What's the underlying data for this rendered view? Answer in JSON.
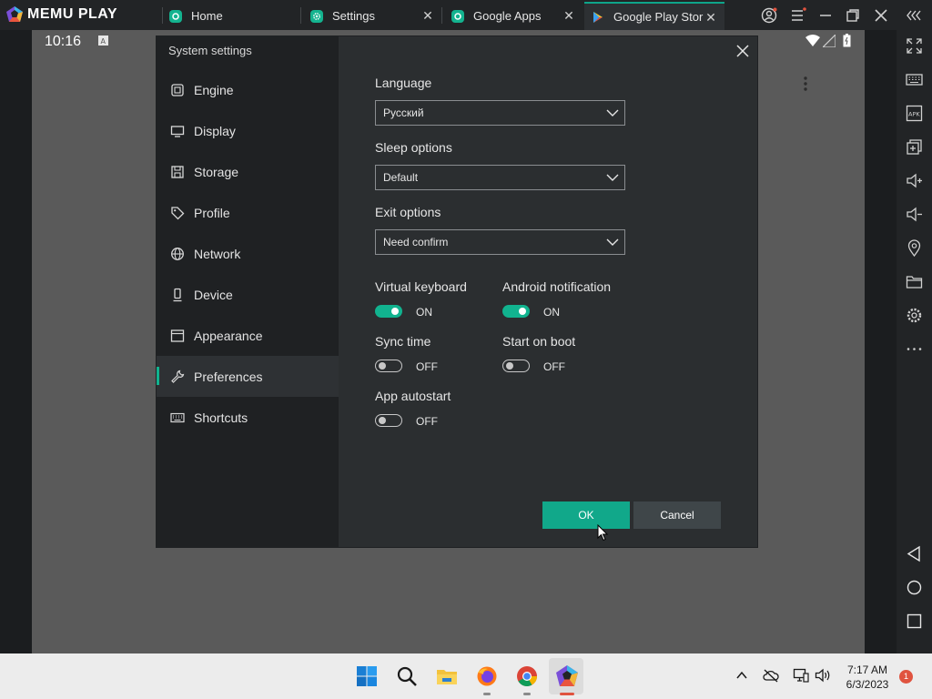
{
  "app": {
    "logo_text": "MEMU PLAY",
    "tabs": [
      {
        "label": "Home",
        "icon": "memu-app-icon",
        "active": false
      },
      {
        "label": "Settings",
        "icon": "gear-icon",
        "active": false
      },
      {
        "label": "Google Apps",
        "icon": "memu-app-icon",
        "active": false
      },
      {
        "label": "Google Play Stor",
        "icon": "play-store-icon",
        "active": true
      }
    ],
    "accent_color": "#11b38f"
  },
  "android": {
    "time": "10:16"
  },
  "dialog": {
    "title": "System settings",
    "nav": [
      {
        "label": "Engine",
        "icon": "chip-icon"
      },
      {
        "label": "Display",
        "icon": "monitor-icon"
      },
      {
        "label": "Storage",
        "icon": "storage-icon"
      },
      {
        "label": "Profile",
        "icon": "tag-icon"
      },
      {
        "label": "Network",
        "icon": "globe-icon"
      },
      {
        "label": "Device",
        "icon": "phone-icon"
      },
      {
        "label": "Appearance",
        "icon": "window-icon"
      },
      {
        "label": "Preferences",
        "icon": "wrench-icon",
        "selected": true
      },
      {
        "label": "Shortcuts",
        "icon": "keyboard-icon"
      }
    ],
    "language": {
      "label": "Language",
      "value": "Русский"
    },
    "sleep": {
      "label": "Sleep options",
      "value": "Default"
    },
    "exit": {
      "label": "Exit options",
      "value": "Need confirm"
    },
    "toggles": {
      "virtual_keyboard": {
        "label": "Virtual keyboard",
        "state": "ON"
      },
      "android_notification": {
        "label": "Android notification",
        "state": "ON"
      },
      "sync_time": {
        "label": "Sync time",
        "state": "OFF"
      },
      "start_on_boot": {
        "label": "Start on boot",
        "state": "OFF"
      },
      "app_autostart": {
        "label": "App autostart",
        "state": "OFF"
      }
    },
    "ok_label": "OK",
    "cancel_label": "Cancel"
  },
  "taskbar": {
    "time": "7:17 AM",
    "date": "6/3/2023",
    "notification_count": "1"
  }
}
